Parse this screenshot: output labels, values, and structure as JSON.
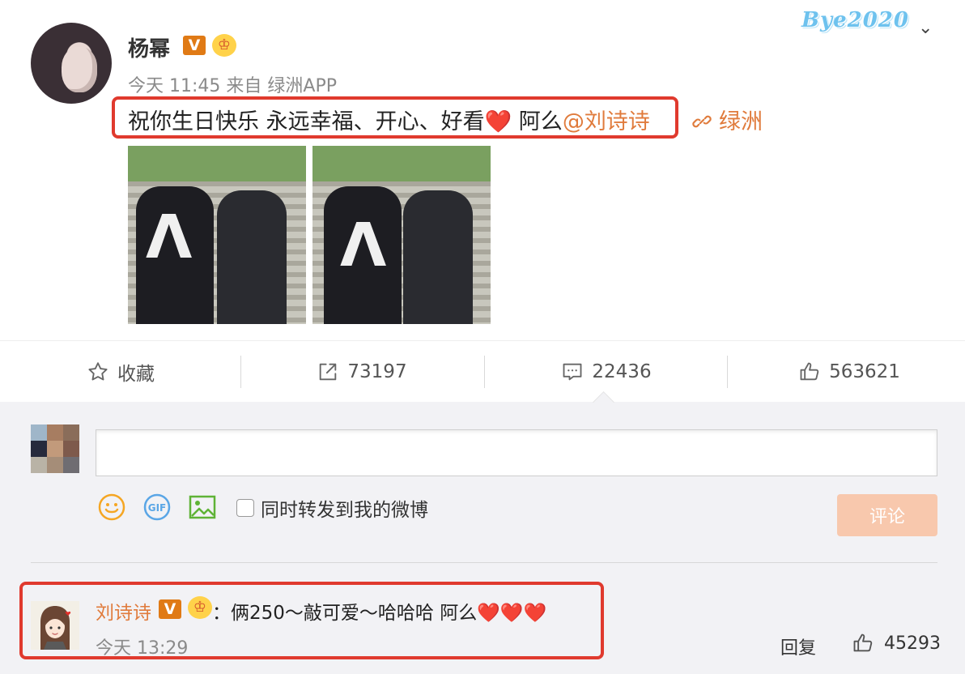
{
  "post": {
    "username": "杨幂",
    "verified_badge": "V",
    "crown_badge": "冠",
    "time": "今天 11:45",
    "source": "来自 绿洲APP",
    "text_main": "祝你生日快乐 永远幸福、开心、好看",
    "heart": "❤️",
    "text_tail": " 阿么",
    "mention": "@刘诗诗",
    "topic_link": "绿洲",
    "watermark": "Bye2020",
    "menu_icon": "chevron-down-icon"
  },
  "actions": {
    "favorite_label": "收藏",
    "repost_count": "73197",
    "comment_count": "22436",
    "like_count": "563621"
  },
  "composer": {
    "input_value": "",
    "forward_label": "同时转发到我的微博",
    "submit_label": "评论",
    "icons": [
      "emoji-icon",
      "gif-icon",
      "image-icon"
    ]
  },
  "reply": {
    "username": "刘诗诗",
    "verified_badge": "V",
    "crown_badge": "冠",
    "colon": "：",
    "text": "俩250～敲可爱～哈哈哈 阿么",
    "hearts": "❤️❤️❤️",
    "time": "今天 13:29",
    "reply_label": "回复",
    "like_count": "45293"
  },
  "colors": {
    "accent": "#e07b3c",
    "highlight_border": "#e03a2e",
    "muted_text": "#8a8a8a",
    "submit_disabled": "#f8c8ad"
  }
}
